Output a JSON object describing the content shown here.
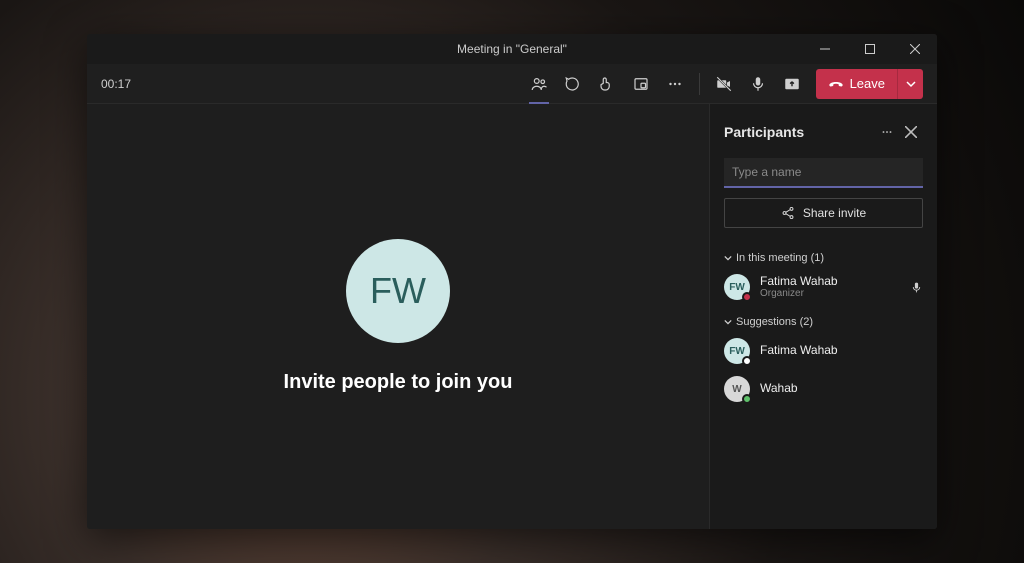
{
  "window": {
    "title": "Meeting in \"General\""
  },
  "toolbar": {
    "timer": "00:17",
    "leave_label": "Leave"
  },
  "stage": {
    "avatar_initials": "FW",
    "invite_message": "Invite people to join you"
  },
  "panel": {
    "title": "Participants",
    "input_placeholder": "Type a name",
    "share_label": "Share invite",
    "sections": {
      "in_meeting": {
        "label": "In this meeting (1)",
        "items": [
          {
            "name": "Fatima Wahab",
            "role": "Organizer",
            "initials": "FW",
            "avatar_bg": "#cde7e6",
            "avatar_fg": "#2a5e5c",
            "status_color": "#c4314b",
            "mic_muted": true
          }
        ]
      },
      "suggestions": {
        "label": "Suggestions (2)",
        "items": [
          {
            "name": "Fatima Wahab",
            "initials": "FW",
            "avatar_bg": "#cde7e6",
            "avatar_fg": "#2a5e5c",
            "status_color": "#ffffff"
          },
          {
            "name": "Wahab",
            "initials": "W",
            "avatar_bg": "#d8d8d8",
            "avatar_fg": "#555",
            "status_color": "#5fc16b"
          }
        ]
      }
    }
  },
  "colors": {
    "accent": "#6264a7",
    "danger": "#c4314b"
  }
}
